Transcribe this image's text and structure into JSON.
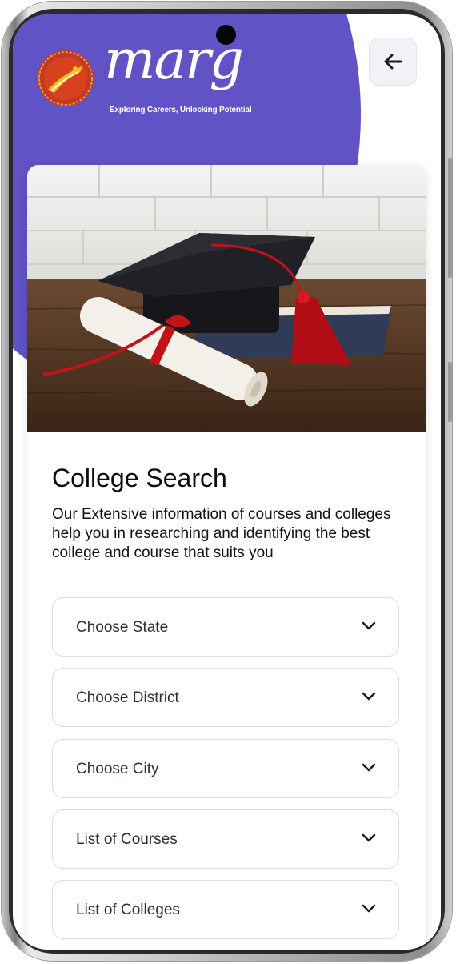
{
  "brand": {
    "name": "marg",
    "tagline": "Exploring Careers,  Unlocking Potential"
  },
  "colors": {
    "header_purple": "#6152c6",
    "text_dark": "#0b0b0b",
    "dropdown_border": "#dcdde2"
  },
  "header": {
    "back_icon": "arrow-left-icon"
  },
  "hero": {
    "image": "graduation-cap-diploma-books-photo"
  },
  "page": {
    "title": "College Search",
    "description": "Our Extensive information of courses and colleges help you in researching and identifying the best college and course that suits you"
  },
  "filters": [
    {
      "label": "Choose State",
      "icon": "chevron-down-icon"
    },
    {
      "label": "Choose District",
      "icon": "chevron-down-icon"
    },
    {
      "label": "Choose City",
      "icon": "chevron-down-icon"
    },
    {
      "label": "List of Courses",
      "icon": "chevron-down-icon"
    },
    {
      "label": "List of Colleges",
      "icon": "chevron-down-icon"
    }
  ]
}
